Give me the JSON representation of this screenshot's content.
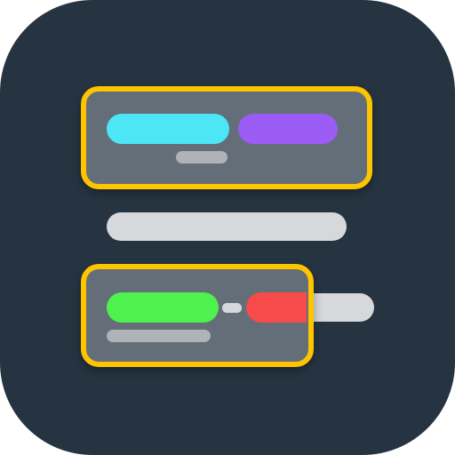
{
  "colors": {
    "background": "#263442",
    "card_fill": "#646E78",
    "card_border": "#FDC500",
    "bar_light": "#D6D8DB",
    "small_gray": "#AFB2B6",
    "cyan": "#4DE6F5",
    "purple": "#9B5CF6",
    "green": "#4EF14E",
    "red": "#F74B4B"
  },
  "icons": {
    "app": "layout-components-icon"
  }
}
